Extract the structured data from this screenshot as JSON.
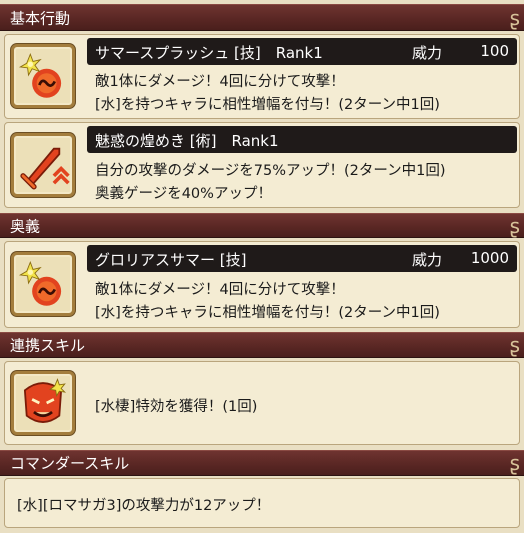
{
  "sections": {
    "basic": "基本行動",
    "ougi": "奥義",
    "renkei": "連携スキル",
    "commander": "コマンダースキル"
  },
  "skills": {
    "summer_splash": {
      "name": "サマースプラッシュ [技]　Rank1",
      "power_label": "威力",
      "power": "100",
      "line1": "敵1体にダメージ！4回に分けて攻撃！",
      "line2": "[水]を持つキャラに相性増幅を付与！(2ターン中1回)",
      "icon": "water-burst-icon"
    },
    "miwaku": {
      "name": "魅惑の煌めき [術]　Rank1",
      "line1": "自分の攻撃のダメージを75%アップ！(2ターン中1回)",
      "line2": "奥義ゲージを40%アップ！",
      "icon": "sword-buff-icon"
    },
    "glorious_summer": {
      "name": "グロリアスサマー [技]",
      "power_label": "威力",
      "power": "1000",
      "line1": "敵1体にダメージ！4回に分けて攻撃！",
      "line2": "[水]を持つキャラに相性増幅を付与！(2ターン中1回)",
      "icon": "water-burst-icon"
    },
    "renkei": {
      "line1": "[水棲]特効を獲得！(1回)",
      "icon": "demon-face-icon"
    },
    "commander": {
      "line1": "[水][ロマサガ3]の攻撃力が12アップ！"
    }
  },
  "colors": {
    "header_bg": "#5a2724",
    "title_bar_bg": "#1f1a19",
    "card_bg": "#f4ecd3",
    "icon_accent": "#e2431f"
  }
}
